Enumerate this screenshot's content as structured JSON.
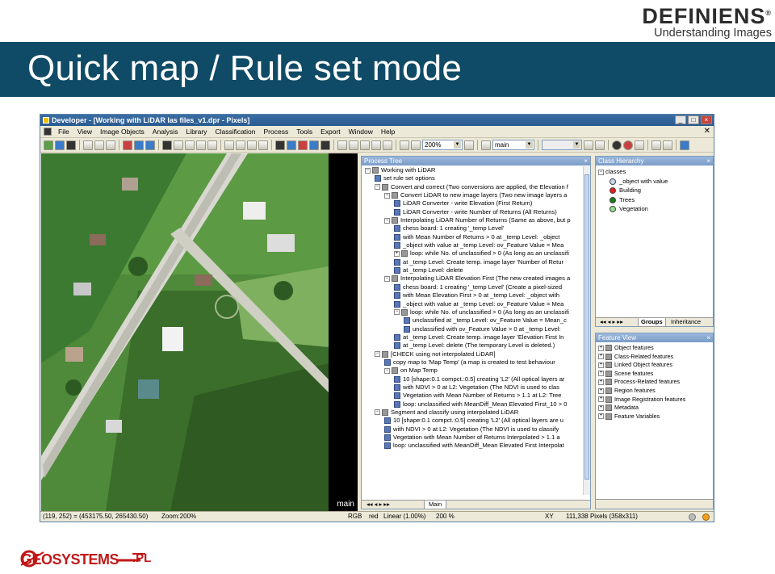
{
  "brand": {
    "name": "DEFINIENS",
    "registered": "®",
    "tagline": "Understanding Images"
  },
  "slide": {
    "title": "Quick map / Rule set mode"
  },
  "app": {
    "title": "Developer - [Working with LiDAR las files_v1.dpr - Pixels]",
    "menu": [
      "File",
      "View",
      "Image Objects",
      "Analysis",
      "Library",
      "Classification",
      "Process",
      "Tools",
      "Export",
      "Window",
      "Help"
    ],
    "toolbar": {
      "zoom": "200%",
      "map": "main"
    },
    "viewer_label": "main",
    "process_tree": {
      "title": "Process Tree",
      "rows": [
        {
          "text": "Working with LiDAR",
          "toggle": "-"
        },
        {
          "text": "set rule set options",
          "toggle": ""
        },
        {
          "text": "Convert and correct   (Two conversions are applied, the Elevation f",
          "toggle": "-"
        },
        {
          "text": "Convert LiDAR to new image layers   (Two new image layers a",
          "toggle": "-"
        },
        {
          "text": "LiDAR Converter - write Elevation (First Return)",
          "toggle": ""
        },
        {
          "text": "LiDAR Converter - write Number of Returns (All Returns)",
          "toggle": ""
        },
        {
          "text": "Interpolating LiDAR Number of Returns   (Same as above, but p",
          "toggle": "-"
        },
        {
          "text": "chess board: 1 creating '_temp Level'",
          "toggle": ""
        },
        {
          "text": "with Mean Number of Returns > 0  at  _temp Level: _object",
          "toggle": ""
        },
        {
          "text": "_object with value at  _temp Level: ov_Feature Value = Mea",
          "toggle": ""
        },
        {
          "text": "loop: while No. of unclassified > 0   (As long as an unclassifi",
          "toggle": "+"
        },
        {
          "text": "at  _temp Level: Create temp. image layer 'Number of Retur",
          "toggle": ""
        },
        {
          "text": "at  _temp Level: delete",
          "toggle": ""
        },
        {
          "text": "Interpolating LiDAR Elevation First   (The new created images a",
          "toggle": "-"
        },
        {
          "text": "chess board: 1 creating '_temp Level'   (Create a pixel-sized",
          "toggle": ""
        },
        {
          "text": "with Mean Elevation First > 0  at  _temp Level: _object with",
          "toggle": ""
        },
        {
          "text": "_object with value at  _temp Level: ov_Feature Value = Mea",
          "toggle": ""
        },
        {
          "text": "loop: while No. of unclassified > 0   (As long as an unclassifi",
          "toggle": "-"
        },
        {
          "text": "unclassified at  _temp Level: ov_Feature Value = Mean_c",
          "toggle": ""
        },
        {
          "text": "unclassified with ov_Feature Value > 0  at  _temp Level:",
          "toggle": ""
        },
        {
          "text": "at  _temp Level: Create temp. image layer 'Elevation First In",
          "toggle": ""
        },
        {
          "text": "at  _temp Level: delete   (The temporary Level is deleted.)",
          "toggle": ""
        },
        {
          "text": "[CHECK using not interpolated LiDAR]",
          "toggle": "-"
        },
        {
          "text": "copy map to 'Map Temp'   (a map is created to test behaviour",
          "toggle": ""
        },
        {
          "text": "on Map Temp",
          "toggle": "-"
        },
        {
          "text": "10 [shape:0.1 compct.:0.5] creating 'L2'   (All optical layers ar",
          "toggle": ""
        },
        {
          "text": "with NDVI > 0  at  L2: Vegetation   (The NDVI is used to clas",
          "toggle": ""
        },
        {
          "text": "Vegetation with Mean Number of Returns > 1.1  at  L2: Tree",
          "toggle": ""
        },
        {
          "text": "loop: unclassified with MeanDiff_Mean Elevated First_10 > 0",
          "toggle": ""
        },
        {
          "text": "Segment and classify using interpolated LiDAR",
          "toggle": "-"
        },
        {
          "text": "10 [shape:0.1 compct.:0.5] creating 'L2'   (All optical layers are u",
          "toggle": ""
        },
        {
          "text": "with NDVI > 0  at  L2: Vegetation   (The NDVI is used to classify",
          "toggle": ""
        },
        {
          "text": "Vegetation with Mean Number of Returns Interpolated > 1.1  a",
          "toggle": ""
        },
        {
          "text": "loop: unclassified with MeanDiff_Mean Elevated First Interpolat",
          "toggle": ""
        }
      ],
      "tab": "Main"
    },
    "class_hierarchy": {
      "title": "Class Hierarchy",
      "root": "classes",
      "classes": [
        {
          "name": "_object with value",
          "color": "#c8dcf0"
        },
        {
          "name": "Building",
          "color": "#e02020"
        },
        {
          "name": "Trees",
          "color": "#1c7a1c"
        },
        {
          "name": "Vegetation",
          "color": "#8ee08e"
        }
      ],
      "tabs": [
        "Groups",
        "Inheritance"
      ]
    },
    "feature_view": {
      "title": "Feature View",
      "items": [
        "Object features",
        "Class-Related features",
        "Linked Object features",
        "Scene features",
        "Process-Related features",
        "Region features",
        "Image Registration features",
        "Metadata",
        "Feature Variables"
      ]
    },
    "status": {
      "coords": "(119, 252) = (453175.50, 265430.50)",
      "zoom": "Zoom:200%",
      "mode": "RGB",
      "band": "red",
      "stretch": "Linear (1.00%)",
      "percent": "200 %",
      "axes": "XY",
      "pixels": "111,338 Pixels  (358x311)"
    }
  },
  "footer_logo": {
    "text": "GEOSYSTEMS",
    "suffix": ".PL"
  }
}
